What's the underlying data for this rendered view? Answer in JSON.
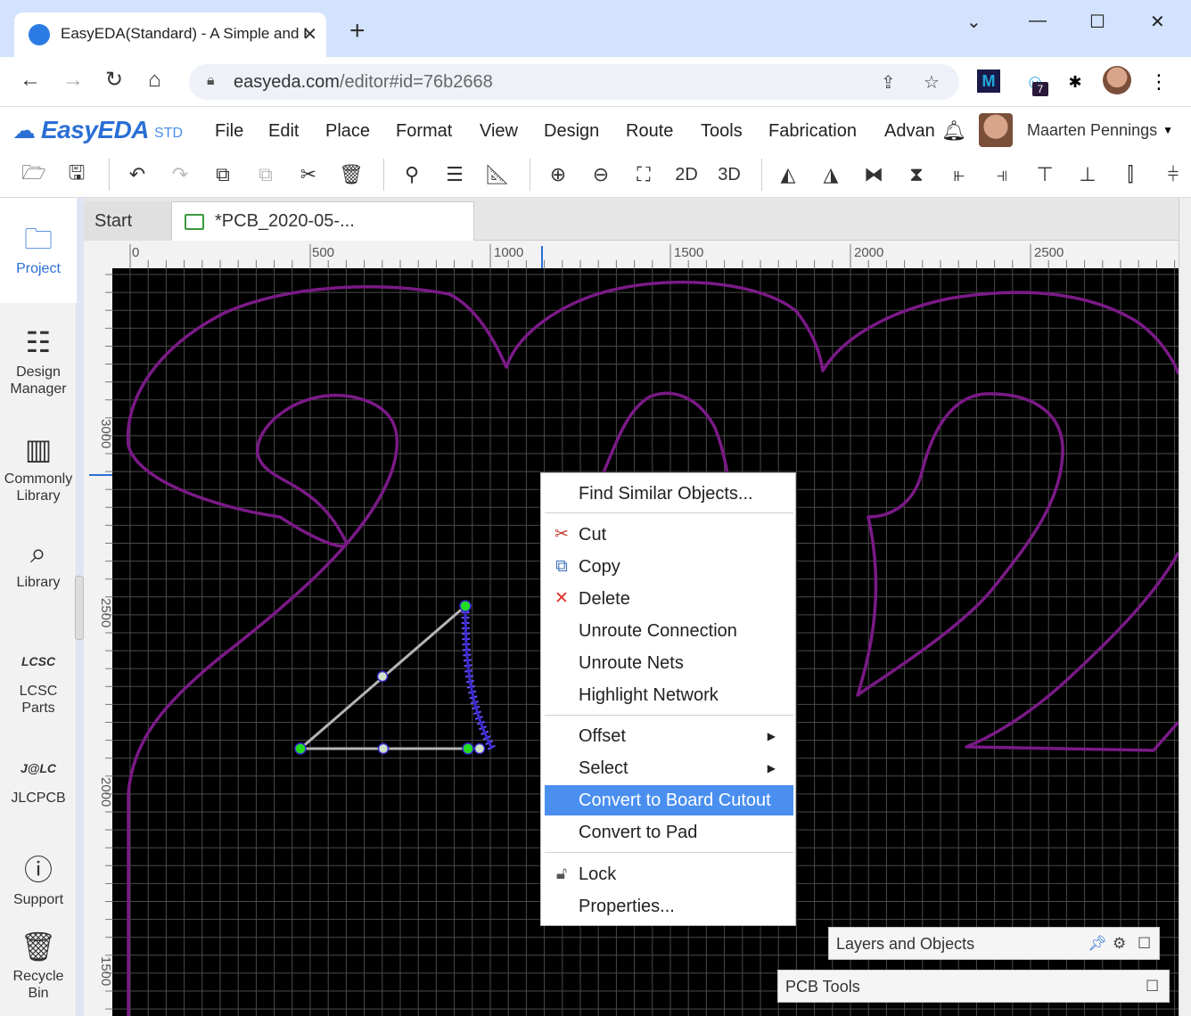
{
  "browser": {
    "tab_title": "EasyEDA(Standard) - A Simple and Powerful Electronic Circuit Design Tool",
    "url_host": "easyeda.com",
    "url_path": "/editor#id=76b2668",
    "ext_badge": "7",
    "ext_m": "M"
  },
  "app": {
    "logo_name": "EasyEDA",
    "logo_suffix": "STD",
    "menu": [
      "File",
      "Edit",
      "Place",
      "Format",
      "View",
      "Design",
      "Route",
      "Tools",
      "Fabrication",
      "Advan"
    ],
    "user_name": "Maarten Pennings",
    "toolbar_2d": "2D",
    "toolbar_3d": "3D"
  },
  "sidebar": [
    {
      "label": "Project",
      "icon": "folder-icon"
    },
    {
      "label": "Design Manager",
      "icon": "list-icon"
    },
    {
      "label": "Commonly Library",
      "icon": "chip-icon"
    },
    {
      "label": "Library",
      "icon": "search-chip-icon"
    },
    {
      "label": "LCSC Parts",
      "icon": "lcsc-icon"
    },
    {
      "label": "JLCPCB",
      "icon": "jlc-icon"
    },
    {
      "label": "Support",
      "icon": "help-icon"
    },
    {
      "label": "Recycle Bin",
      "icon": "trash-icon"
    }
  ],
  "lcsc_mark": "LCSC",
  "jlc_mark": "J@LC",
  "doc_tabs": {
    "start": "Start",
    "pcb": "*PCB_2020-05-..."
  },
  "rulers": {
    "top": [
      "0",
      "500",
      "1000",
      "1500",
      "2000",
      "2500"
    ],
    "left": [
      "3000",
      "2500",
      "2000",
      "1500"
    ]
  },
  "context_menu": {
    "items": [
      {
        "label": "Find Similar Objects...",
        "icon": ""
      },
      {
        "label": "Cut",
        "icon": "scissors-icon"
      },
      {
        "label": "Copy",
        "icon": "copy-icon"
      },
      {
        "label": "Delete",
        "icon": "delete-icon"
      },
      {
        "label": "Unroute Connection",
        "icon": ""
      },
      {
        "label": "Unroute Nets",
        "icon": ""
      },
      {
        "label": "Highlight Network",
        "icon": ""
      },
      {
        "label": "Offset",
        "icon": ""
      },
      {
        "label": "Select",
        "icon": ""
      },
      {
        "label": "Convert to Board Cutout",
        "icon": ""
      },
      {
        "label": "Convert to Pad",
        "icon": ""
      },
      {
        "label": "Lock",
        "icon": "lock-icon"
      },
      {
        "label": "Properties...",
        "icon": ""
      }
    ],
    "highlighted": "Convert to Board Cutout"
  },
  "panels": {
    "layers": "Layers and Objects",
    "pcb_tools": "PCB Tools"
  },
  "colors": {
    "accent": "#2b6fd6",
    "outline": "#7a1a86",
    "selection": "#6a4cff",
    "handle": "#22dd22",
    "grid": "#4a4a4a",
    "highlight": "#4a8ff0"
  }
}
